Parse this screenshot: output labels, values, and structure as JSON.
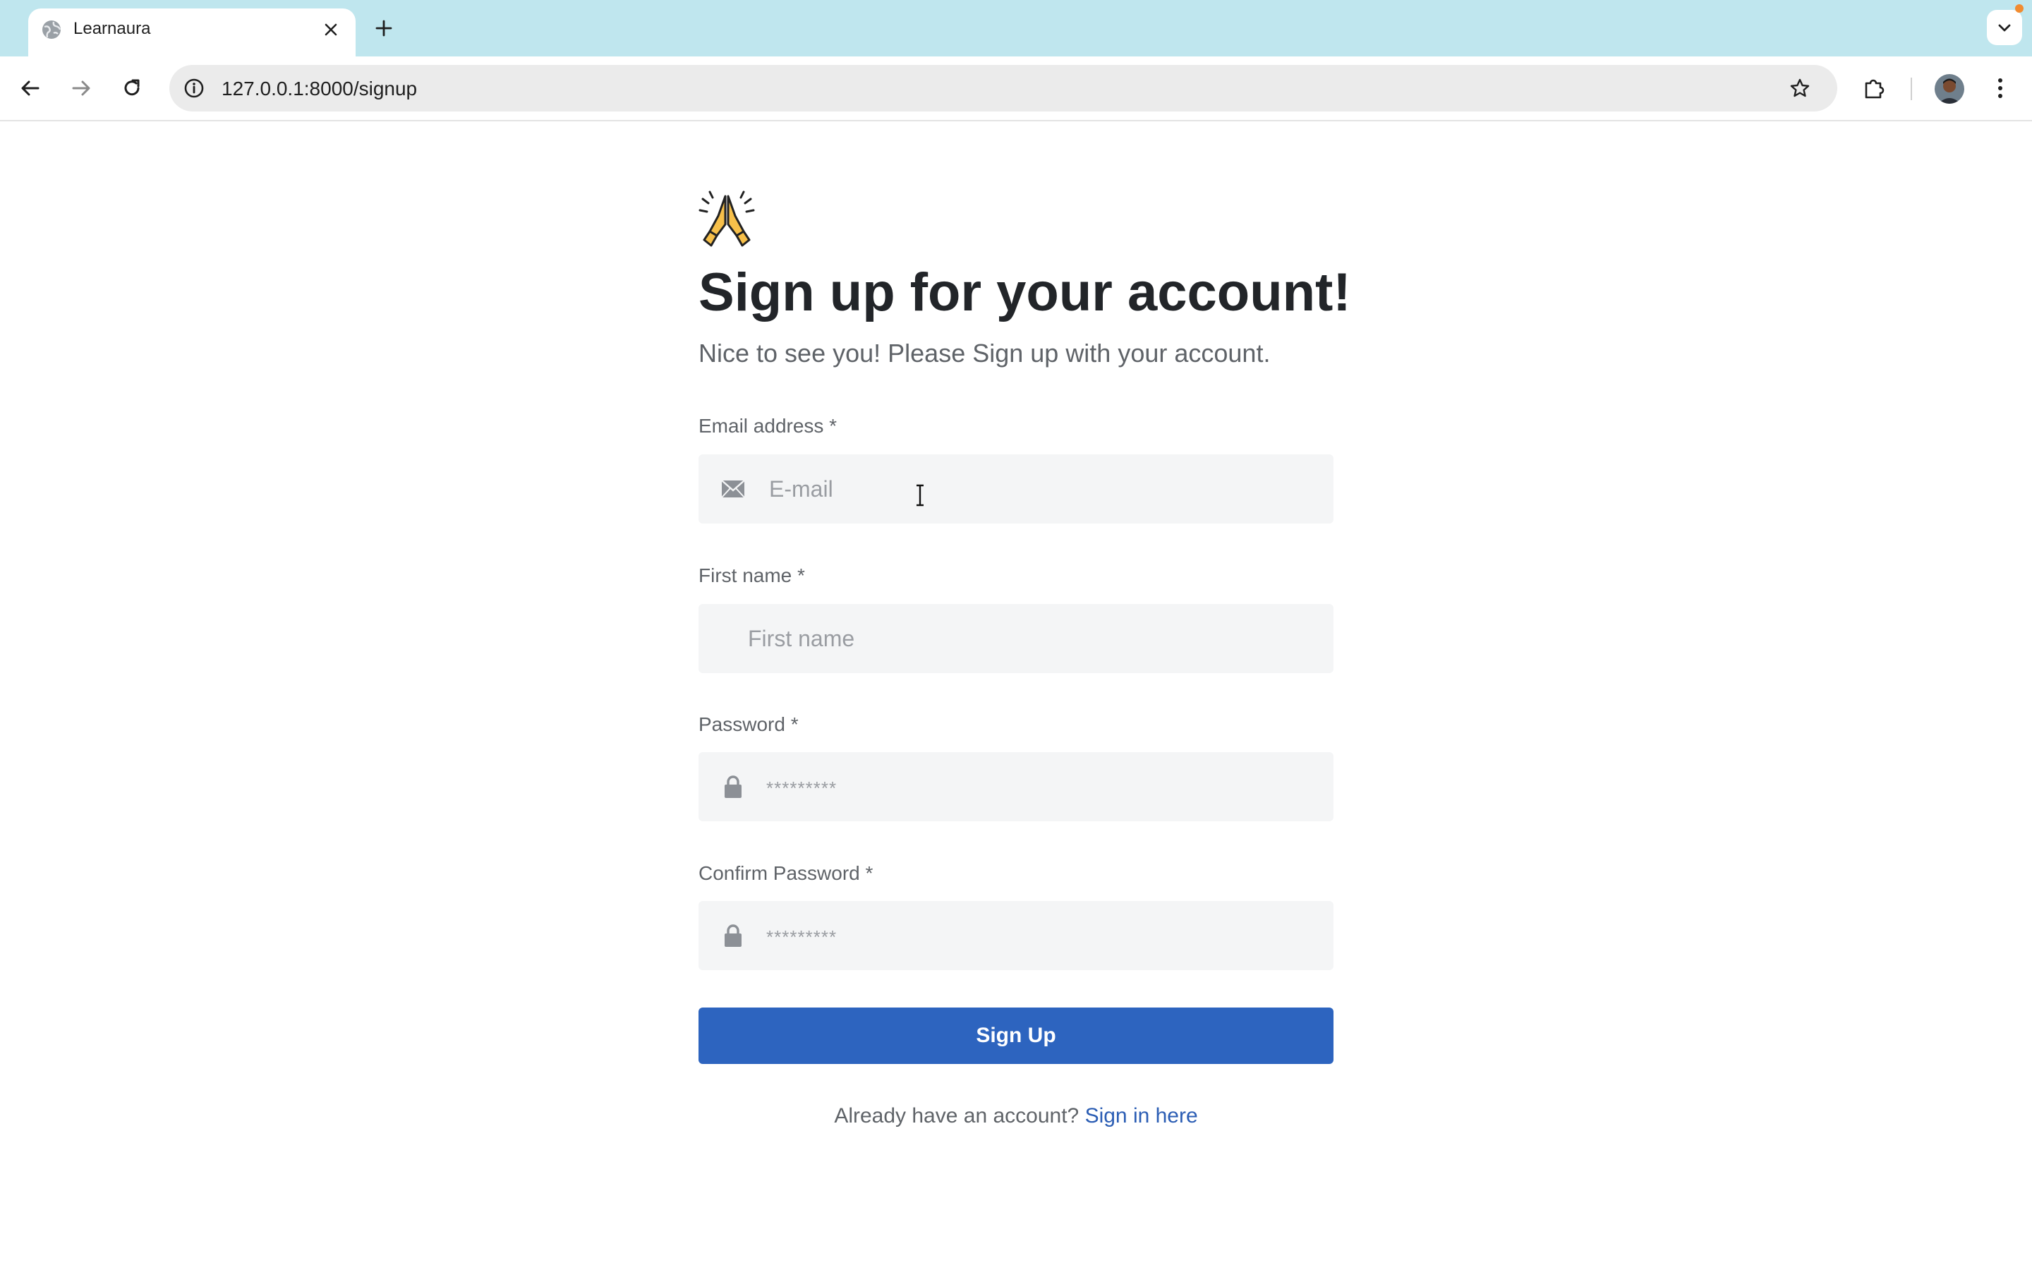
{
  "browser": {
    "tab_title": "Learnaura",
    "url": "127.0.0.1:8000/signup",
    "icons": {
      "favicon": "globe-icon",
      "close": "close-icon",
      "new_tab": "plus-icon",
      "tab_search": "chevron-down-icon",
      "back": "arrow-left-icon",
      "forward": "arrow-right-icon",
      "reload": "reload-icon",
      "site_info": "info-icon",
      "bookmark": "star-icon",
      "extensions": "puzzle-icon",
      "profile": "avatar",
      "menu": "kebab-menu-icon"
    }
  },
  "signup": {
    "emoji": "folded-hands-icon",
    "title": "Sign up for your account!",
    "subtitle": "Nice to see you! Please Sign up with your account.",
    "fields": [
      {
        "label": "Email address *",
        "placeholder": "E-mail",
        "icon": "mail-icon"
      },
      {
        "label": "First name *",
        "placeholder": "First name"
      },
      {
        "label": "Password *",
        "placeholder": "*********",
        "icon": "lock-icon"
      },
      {
        "label": "Confirm Password *",
        "placeholder": "*********",
        "icon": "lock-icon"
      }
    ],
    "submit_label": "Sign Up",
    "footer_text": "Already have an account?",
    "footer_link": "Sign in here"
  },
  "colors": {
    "tabstrip": "#bfe6ee",
    "primary_button": "#2d64bf",
    "link": "#2b5db4",
    "field_bg": "#f4f5f6",
    "heading": "#222529"
  }
}
